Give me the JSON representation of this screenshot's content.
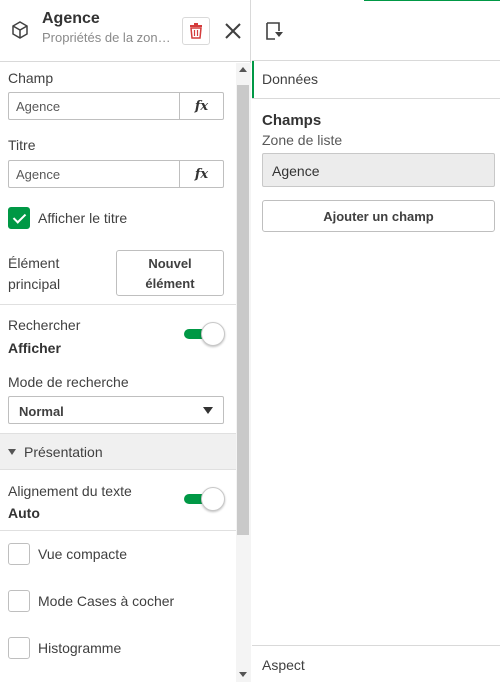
{
  "header": {
    "title": "Agence",
    "subtitle": "Propriétés de la zon…"
  },
  "props": {
    "champ_label": "Champ",
    "champ_value": "Agence",
    "titre_label": "Titre",
    "titre_value": "Agence",
    "fx_label": "fx",
    "show_title_label": "Afficher le titre",
    "show_title_checked": true,
    "master_item_label_1": "Élément",
    "master_item_label_2": "principal",
    "new_item_button_1": "Nouvel",
    "new_item_button_2": "élément",
    "search_label": "Rechercher",
    "search_value": "Afficher",
    "search_mode_label": "Mode de recherche",
    "search_mode_value": "Normal"
  },
  "presentation": {
    "section_label": "Présentation",
    "text_align_label": "Alignement du texte",
    "text_align_value": "Auto",
    "compact_label": "Vue compacte",
    "checkbox_mode_label": "Mode Cases à cocher",
    "histogram_label": "Histogramme"
  },
  "right": {
    "tab_data": "Données",
    "fields_heading": "Champs",
    "fields_sub": "Zone de liste",
    "field_item": "Agence",
    "add_field_button": "Ajouter un champ",
    "tab_aspect": "Aspect"
  },
  "colors": {
    "accent": "#009845",
    "delete": "#d43c3c"
  }
}
